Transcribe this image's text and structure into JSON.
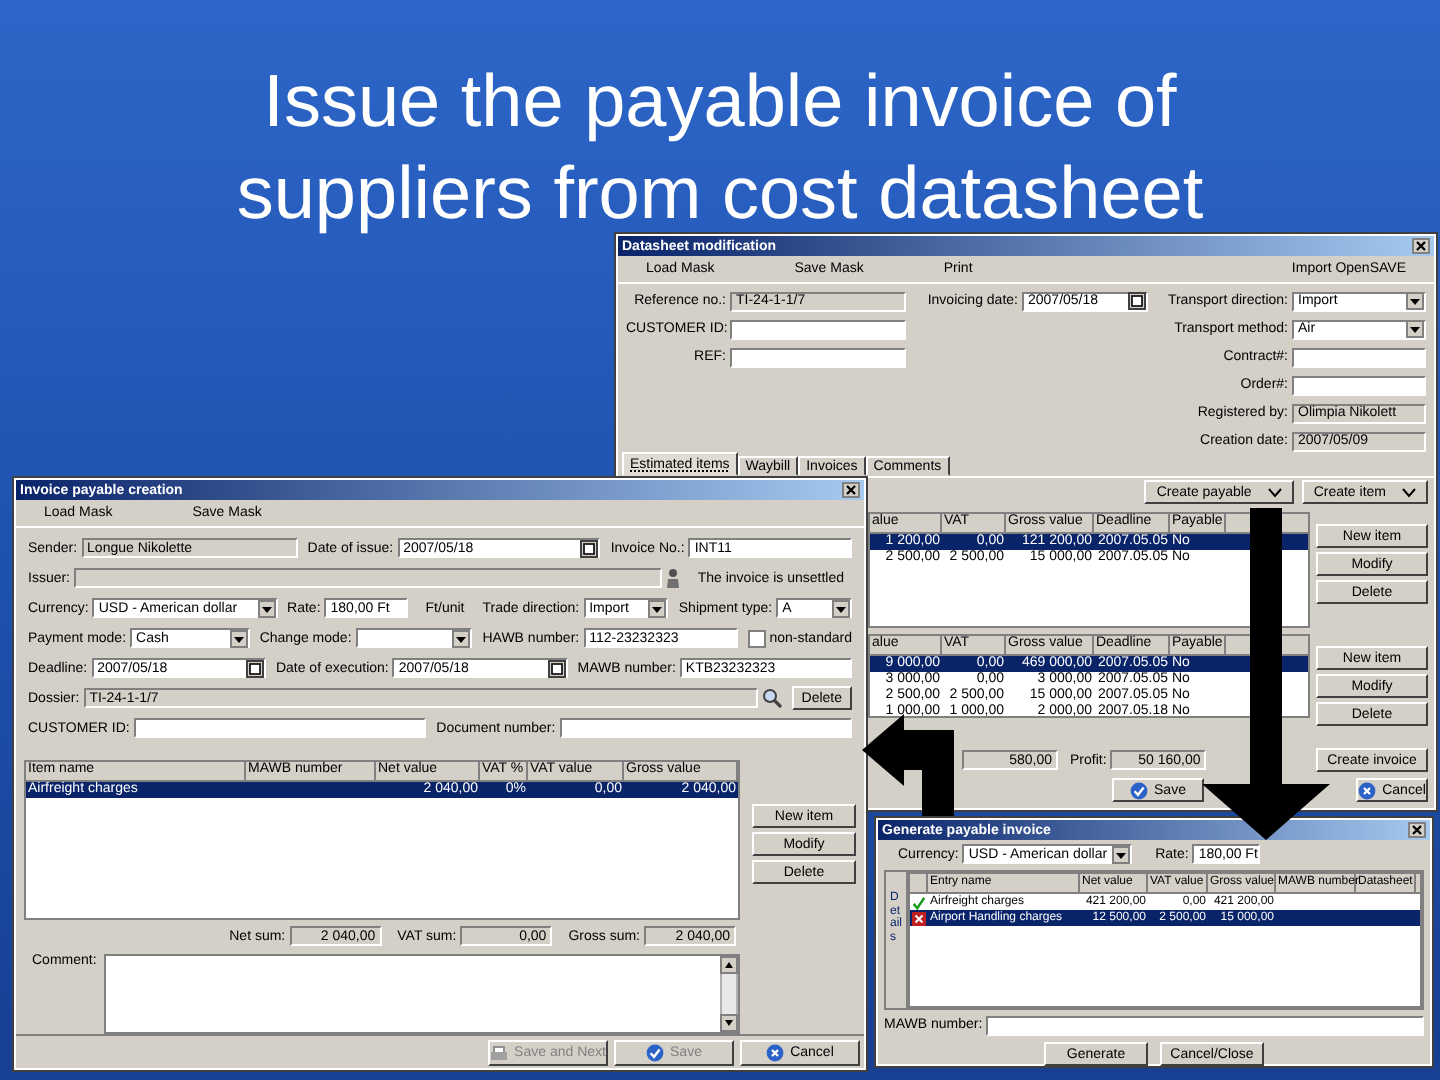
{
  "slide_title": "Issue the payable invoice of suppliers from cost datasheet",
  "datasheet_window": {
    "title": "Datasheet modification",
    "toolbar": [
      "Load Mask",
      "Save Mask",
      "Print",
      "Import OpenSAVE"
    ],
    "fields_left": [
      {
        "label": "Reference no.:",
        "kind": "readonly",
        "value": "TI-24-1-1/7"
      },
      {
        "label": "CUSTOMER ID:",
        "kind": "text"
      },
      {
        "label": "REF:",
        "kind": "text"
      }
    ],
    "fields_middle": [
      {
        "label": "Invoicing date:",
        "kind": "date",
        "value": "2007/05/18"
      }
    ],
    "fields_right": [
      {
        "label": "Transport direction:",
        "kind": "select",
        "value": "Import"
      },
      {
        "label": "Transport method:",
        "kind": "select",
        "value": "Air"
      },
      {
        "label": "Contract#:",
        "kind": "text"
      },
      {
        "label": "Order#:",
        "kind": "text"
      },
      {
        "label": "Registered by:",
        "kind": "readonly",
        "value": "Olimpia Nikolett"
      },
      {
        "label": "Creation date:",
        "kind": "readonly",
        "value": "2007/05/09"
      }
    ],
    "tabs": [
      {
        "label": "Estimated items",
        "selected": true
      },
      {
        "label": "Waybill",
        "selected": false
      },
      {
        "label": "Invoices",
        "selected": false
      },
      {
        "label": "Comments",
        "selected": false
      }
    ],
    "actions": [
      "Create payable",
      "Create item"
    ],
    "tables": [
      {
        "columns": [
          "alue",
          "VAT",
          "Gross value",
          "Deadline",
          "Payable"
        ],
        "rows": [
          {
            "cells": [
              "1 200,00",
              "0,00",
              "121 200,00",
              "2007.05.05",
              "No"
            ],
            "selected": true
          },
          {
            "cells": [
              "2 500,00",
              "2 500,00",
              "15 000,00",
              "2007.05.05",
              "No"
            ],
            "selected": false
          }
        ],
        "buttons": [
          "New item",
          "Modify",
          "Delete"
        ]
      },
      {
        "columns": [
          "alue",
          "VAT",
          "Gross value",
          "Deadline",
          "Payable"
        ],
        "rows": [
          {
            "cells": [
              "9 000,00",
              "0,00",
              "469 000,00",
              "2007.05.05",
              "No"
            ],
            "selected": true
          },
          {
            "cells": [
              "3 000,00",
              "0,00",
              "3 000,00",
              "2007.05.05",
              "No"
            ],
            "selected": false
          },
          {
            "cells": [
              "2 500,00",
              "2 500,00",
              "15 000,00",
              "2007.05.05",
              "No"
            ],
            "selected": false
          },
          {
            "cells": [
              "1 000,00",
              "1 000,00",
              "2 000,00",
              "2007.05.18",
              "No"
            ],
            "selected": false
          }
        ],
        "buttons": [
          "New item",
          "Modify",
          "Delete"
        ]
      }
    ],
    "totals": [
      {
        "kind": "readonly",
        "value": "580,00"
      },
      {
        "label": "Profit:",
        "kind": "readonly",
        "value": "50 160,00"
      }
    ],
    "create_invoice": "Create invoice",
    "footer_buttons": [
      {
        "label": "Save",
        "kind": "save",
        "disabled": false
      },
      {
        "label": "Cancel",
        "kind": "cancel",
        "disabled": false
      }
    ]
  },
  "invoice_window": {
    "title": "Invoice payable creation",
    "toolbar": [
      "Load Mask",
      "Save Mask"
    ],
    "form_rows": [
      [
        {
          "label": "Sender:",
          "kind": "readonly",
          "value": "Longue Nikolette"
        },
        {
          "label": "Date of issue:",
          "kind": "date",
          "value": "2007/05/18"
        },
        {
          "label": "Invoice No.:",
          "kind": "text",
          "value": "INT11"
        }
      ],
      [
        {
          "label": "Issuer:",
          "kind": "lookup"
        },
        {
          "kind": "note",
          "value": "The invoice is unsettled"
        }
      ],
      [
        {
          "label": "Currency:",
          "kind": "select",
          "value": "USD - American dollar"
        },
        {
          "label": "Rate:",
          "kind": "text",
          "value": "180,00 Ft"
        },
        {
          "kind": "note",
          "value": "Ft/unit"
        },
        {
          "label": "Trade direction:",
          "kind": "select",
          "value": "Import"
        },
        {
          "label": "Shipment type:",
          "kind": "select",
          "value": "A"
        }
      ],
      [
        {
          "label": "Payment mode:",
          "kind": "select",
          "value": "Cash"
        },
        {
          "label": "Change mode:",
          "kind": "select"
        },
        {
          "label": "HAWB number:",
          "kind": "text",
          "value": "112-23232323"
        },
        {
          "kind": "checkbox",
          "label": "non-standard",
          "checked": false
        }
      ],
      [
        {
          "label": "Deadline:",
          "kind": "date",
          "value": "2007/05/18"
        },
        {
          "label": "Date of execution:",
          "kind": "date",
          "value": "2007/05/18"
        },
        {
          "label": "MAWB number:",
          "kind": "text",
          "value": "KTB23232323"
        }
      ],
      [
        {
          "label": "Dossier:",
          "kind": "search",
          "value": "TI-24-1-1/7"
        },
        {
          "kind": "button",
          "label": "Delete"
        }
      ],
      [
        {
          "label": "CUSTOMER ID:",
          "kind": "text"
        },
        {
          "label": "Document number:",
          "kind": "text"
        }
      ]
    ],
    "table": {
      "columns": [
        "Item name",
        "MAWB number",
        "Net value",
        "VAT %",
        "VAT value",
        "Gross value"
      ],
      "rows": [
        {
          "cells": [
            "Airfreight charges",
            null,
            "2 040,00",
            "0%",
            "0,00",
            "2 040,00"
          ],
          "selected": true
        }
      ]
    },
    "buttons": [
      "New item",
      "Modify",
      "Delete"
    ],
    "totals": [
      {
        "label": "Net sum:",
        "kind": "readonly",
        "value": "2 040,00"
      },
      {
        "label": "VAT sum:",
        "kind": "readonly",
        "value": "0,00"
      },
      {
        "label": "Gross sum:",
        "kind": "readonly",
        "value": "2 040,00"
      }
    ],
    "comment_label": "Comment:",
    "footer_buttons": [
      {
        "label": "Save and Next",
        "kind": "save_next",
        "disabled": true
      },
      {
        "label": "Save",
        "kind": "save",
        "disabled": true
      },
      {
        "label": "Cancel",
        "kind": "cancel",
        "disabled": false
      }
    ]
  },
  "generate_window": {
    "title": "Generate payable invoice",
    "fields": [
      {
        "label": "Currency:",
        "kind": "select",
        "value": "USD - American dollar"
      },
      {
        "label": "Rate:",
        "kind": "text",
        "value": "180,00 Ft"
      }
    ],
    "side_label": "Details",
    "table": {
      "columns": [
        "Entry name",
        "Net value",
        "VAT value",
        "Gross value",
        "MAWB number",
        "Datasheet"
      ],
      "rows": [
        {
          "valid": true,
          "cells": [
            "Airfreight charges",
            "421 200,00",
            "0,00",
            "421 200,00",
            null,
            null
          ],
          "selected": false
        },
        {
          "valid": false,
          "cells": [
            "Airport Handling charges",
            "12 500,00",
            "2 500,00",
            "15 000,00",
            null,
            null
          ],
          "selected": true
        }
      ]
    },
    "mawb_field": {
      "label": "MAWB number:",
      "kind": "text"
    },
    "buttons": [
      "Generate",
      "Cancel/Close"
    ]
  }
}
